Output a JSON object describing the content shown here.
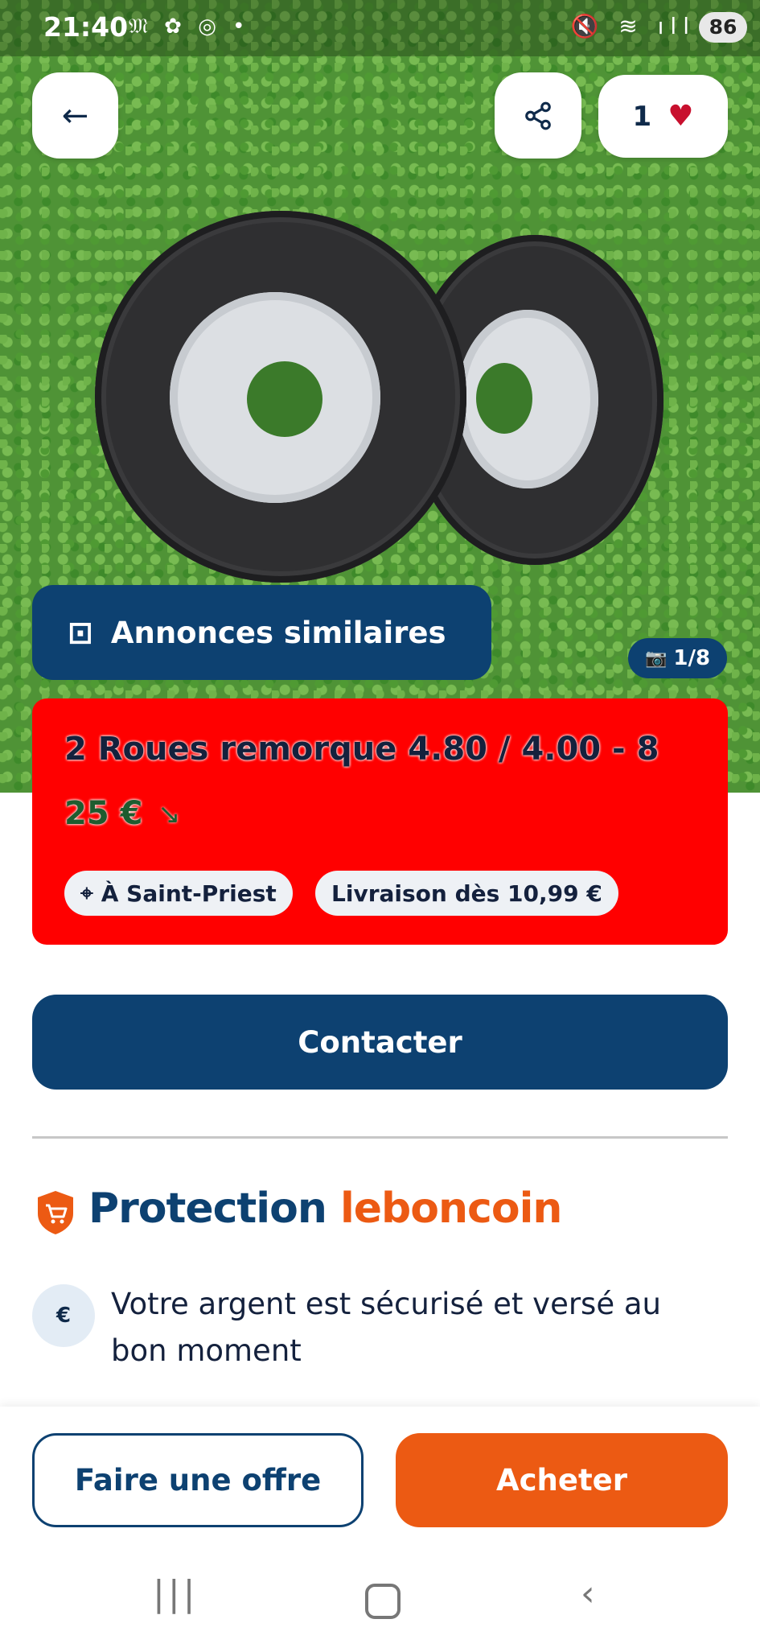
{
  "status_bar": {
    "time": "21:40",
    "left_icons": "𝔐 ✿ ◎ •",
    "right_icons": "🔇 ≋ ıll",
    "battery": "86"
  },
  "header": {
    "back_icon": "←",
    "share_icon": "share-icon",
    "favorites_count": "1",
    "heart_icon": "♥"
  },
  "gallery": {
    "similar_label": "Annonces similaires",
    "similar_icon": "⊡",
    "photo_counter": "1/8",
    "camera_icon": "📷"
  },
  "listing": {
    "title": "2 Roues remorque 4.80 / 4.00 - 8",
    "price": "25 €",
    "price_trend_icon": "↘",
    "location_label": "À Saint-Priest",
    "location_icon": "⌖",
    "shipping_label": "Livraison dès 10,99 €"
  },
  "actions": {
    "contact_label": "Contacter",
    "offer_label": "Faire une offre",
    "buy_label": "Acheter"
  },
  "protection": {
    "title_part1": "Protection",
    "title_part2": "leboncoin",
    "feature_text": "Votre argent est sécurisé et versé au bon moment",
    "feature_icon": "€"
  },
  "navbar": {
    "recent": "|||",
    "back": "‹"
  },
  "colors": {
    "primary": "#0d4171",
    "accent": "#ec5a13",
    "redaction": "#ff0000",
    "price_green": "#1e5c2f"
  }
}
